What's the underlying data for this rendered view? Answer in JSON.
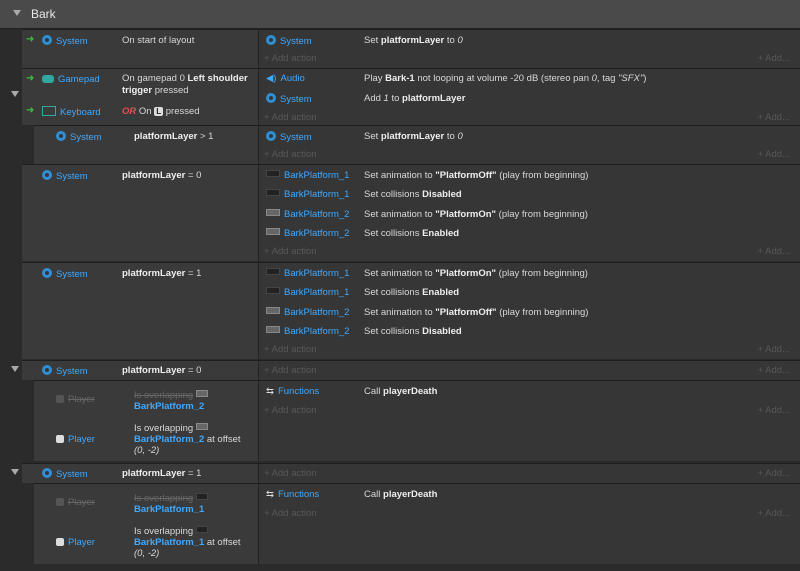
{
  "group": {
    "title": "Bark"
  },
  "labels": {
    "system": "System",
    "gamepad": "Gamepad",
    "keyboard": "Keyboard",
    "audio": "Audio",
    "functions": "Functions",
    "player": "Player",
    "add_action": "+ Add action",
    "add_right": "+ Add...",
    "or": "OR"
  },
  "ev1": {
    "cond": "On start of layout",
    "action_pre": "Set ",
    "action_var": "platformLayer",
    "action_mid": " to ",
    "action_val": "0"
  },
  "ev2": {
    "cond1_pre": "On gamepad 0 ",
    "cond1_bold1": "Left shoulder",
    "cond1_bold2": "trigger",
    "cond1_post": " pressed",
    "cond2_on": "On",
    "cond2_key": "L",
    "cond2_post": "pressed",
    "a1_pre": "Play ",
    "a1_bold": "Bark-1",
    "a1_mid": " not looping at volume -20 dB (stereo pan ",
    "a1_pan": "0",
    "a1_tag": ", tag ",
    "a1_tagval": "\"SFX\"",
    "a1_end": ")",
    "a2_pre": "Add ",
    "a2_val": "1",
    "a2_mid": " to ",
    "a2_var": "platformLayer"
  },
  "ev3": {
    "cond_var": "platformLayer",
    "cond_op": " > 1",
    "action_pre": "Set ",
    "action_var": "platformLayer",
    "action_mid": " to ",
    "action_val": "0"
  },
  "ev4": {
    "cond_var": "platformLayer",
    "cond_op": " = 0",
    "rows": [
      {
        "obj": "BarkPlatform_1",
        "pre": "Set animation to ",
        "bold": "\"PlatformOff\"",
        "post": " (play from beginning)"
      },
      {
        "obj": "BarkPlatform_1",
        "pre": "Set collisions ",
        "bold": "Disabled",
        "post": ""
      },
      {
        "obj": "BarkPlatform_2",
        "pre": "Set animation to ",
        "bold": "\"PlatformOn\"",
        "post": " (play from beginning)"
      },
      {
        "obj": "BarkPlatform_2",
        "pre": "Set collisions ",
        "bold": "Enabled",
        "post": ""
      }
    ]
  },
  "ev5": {
    "cond_var": "platformLayer",
    "cond_op": " = 1",
    "rows": [
      {
        "obj": "BarkPlatform_1",
        "pre": "Set animation to ",
        "bold": "\"PlatformOn\"",
        "post": " (play from beginning)"
      },
      {
        "obj": "BarkPlatform_1",
        "pre": "Set collisions ",
        "bold": "Enabled",
        "post": ""
      },
      {
        "obj": "BarkPlatform_2",
        "pre": "Set animation to ",
        "bold": "\"PlatformOff\"",
        "post": " (play from beginning)"
      },
      {
        "obj": "BarkPlatform_2",
        "pre": "Set collisions ",
        "bold": "Disabled",
        "post": ""
      }
    ]
  },
  "ev6": {
    "cond_var": "platformLayer",
    "cond_op": " = 0"
  },
  "ev7": {
    "c1_text": "Is overlapping",
    "c1_obj": "BarkPlatform_2",
    "c2_text": "Is overlapping",
    "c2_obj": "BarkPlatform_2",
    "c2_post": " at offset",
    "c2_offset": "(0, -2)",
    "action_pre": "Call ",
    "action_fn": "playerDeath"
  },
  "ev8": {
    "cond_var": "platformLayer",
    "cond_op": " = 1"
  },
  "ev9": {
    "c1_text": "Is overlapping",
    "c1_obj": "BarkPlatform_1",
    "c2_text": "Is overlapping",
    "c2_obj": "BarkPlatform_1",
    "c2_post": " at offset",
    "c2_offset": "(0, -2)",
    "action_pre": "Call ",
    "action_fn": "playerDeath"
  }
}
